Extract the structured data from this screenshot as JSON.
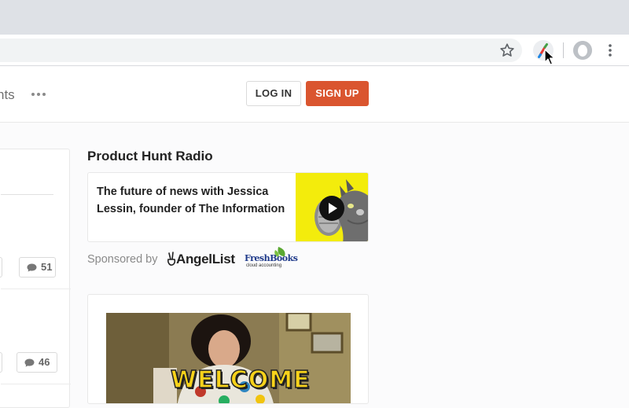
{
  "browser": {
    "star_icon": "bookmark-star-icon",
    "extension_icon": "paintbrush-extension-icon",
    "avatar_icon": "profile-avatar-icon",
    "menu_icon": "kebab-menu-icon"
  },
  "header": {
    "nav_fragment": "nts",
    "more_icon": "ellipsis-icon",
    "login_label": "LOG IN",
    "signup_label": "SIGN UP",
    "signup_color": "#da552f"
  },
  "feed": {
    "items": [
      {
        "comments": "51"
      },
      {
        "comments": "46"
      }
    ]
  },
  "radio": {
    "title": "Product Hunt Radio",
    "episode": "The future of news with Jessica Lessin, founder of The Information",
    "art_background": "#f3ec0c",
    "sponsored_by": "Sponsored by",
    "sponsors": [
      "AngelList",
      "FreshBooks"
    ],
    "freshbooks_tagline": "cloud accounting"
  },
  "welcome": {
    "gif_caption": "WELCOME"
  }
}
